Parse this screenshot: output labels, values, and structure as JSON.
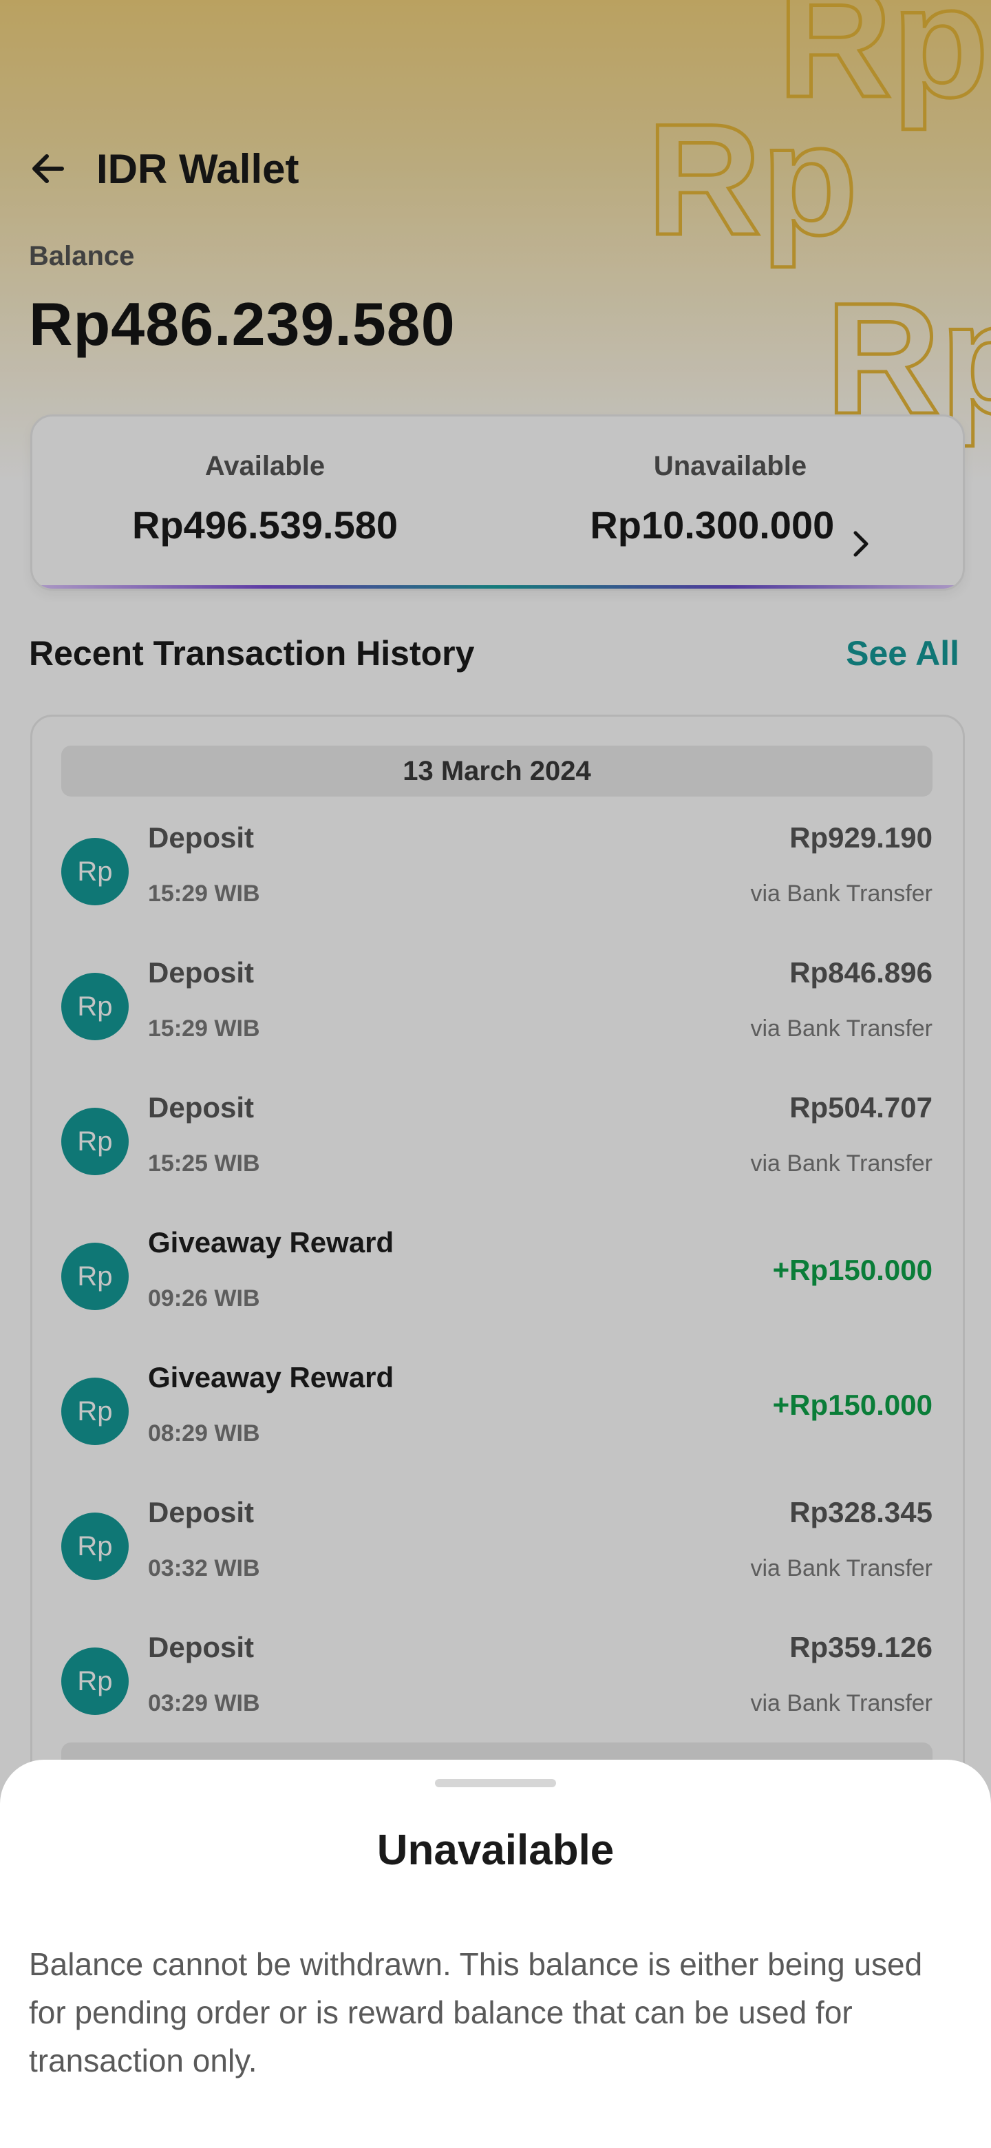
{
  "header": {
    "title": "IDR Wallet"
  },
  "balance": {
    "label": "Balance",
    "value": "Rp486.239.580"
  },
  "balance_card": {
    "available_label": "Available",
    "available_value": "Rp496.539.580",
    "unavailable_label": "Unavailable",
    "unavailable_value": "Rp10.300.000"
  },
  "history": {
    "title": "Recent Transaction History",
    "see_all": "See All",
    "date": "13 March 2024",
    "avatar_text": "Rp",
    "items": [
      {
        "name": "Deposit",
        "time": "15:29 WIB",
        "amount": "Rp929.190",
        "method": "via Bank Transfer"
      },
      {
        "name": "Deposit",
        "time": "15:29 WIB",
        "amount": "Rp846.896",
        "method": "via Bank Transfer"
      },
      {
        "name": "Deposit",
        "time": "15:25 WIB",
        "amount": "Rp504.707",
        "method": "via Bank Transfer"
      },
      {
        "name": "Giveaway Reward",
        "time": "09:26 WIB",
        "amount": "+Rp150.000"
      },
      {
        "name": "Giveaway Reward",
        "time": "08:29 WIB",
        "amount": "+Rp150.000"
      },
      {
        "name": "Deposit",
        "time": "03:32 WIB",
        "amount": "Rp328.345",
        "method": "via Bank Transfer"
      },
      {
        "name": "Deposit",
        "time": "03:29 WIB",
        "amount": "Rp359.126",
        "method": "via Bank Transfer"
      }
    ]
  },
  "sheet": {
    "title": "Unavailable",
    "body": "Balance cannot be withdrawn. This balance is either being used for pending order or is reward balance that can be used for transaction only."
  },
  "colors": {
    "accent": "#159a99",
    "positive": "#0ea34a",
    "hero_gold": "#f3d27e"
  },
  "icons": [
    "arrow-left-icon",
    "chevron-right-icon",
    "rp-logo-pattern"
  ]
}
